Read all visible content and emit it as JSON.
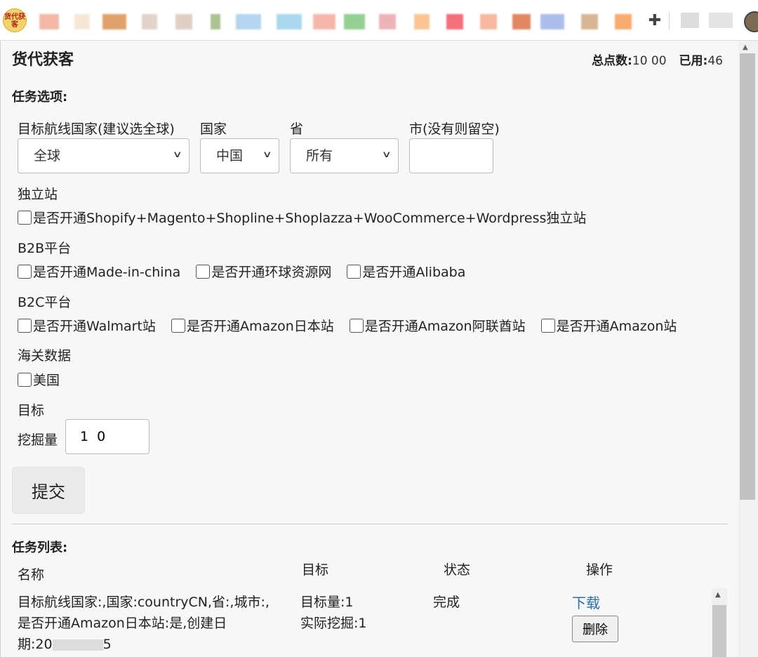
{
  "toolbar": {
    "ext_icon_text": "货代获客",
    "puzzle_icon": "puzzle-icon"
  },
  "header": {
    "title": "货代获客",
    "total_label": "总点数:",
    "total_value": "10  00",
    "used_label": "已用:",
    "used_value": "46"
  },
  "options": {
    "section_title": "任务选项:",
    "route_label": "目标航线国家(建议选全球)",
    "route_value": "全球",
    "country_label": "国家",
    "country_value": "中国",
    "province_label": "省",
    "province_value": "所有",
    "city_label": "市(没有则留空)",
    "city_value": "",
    "independent_label": "独立站",
    "independent_cb": "是否开通Shopify+Magento+Shopline+Shoplazza+WooCommerce+Wordpress独立站",
    "b2b_label": "B2B平台",
    "b2b_cb1": "是否开通Made-in-china",
    "b2b_cb2": "是否开通环球资源网",
    "b2b_cb3": "是否开通Alibaba",
    "b2c_label": "B2C平台",
    "b2c_cb1": "是否开通Walmart站",
    "b2c_cb2": "是否开通Amazon日本站",
    "b2c_cb3": "是否开通Amazon阿联酋站",
    "b2c_cb4": "是否开通Amazon站",
    "customs_label": "海关数据",
    "customs_cb1": "美国",
    "target_label": "目标",
    "amount_label": "挖掘量",
    "amount_value": "1  0",
    "submit_label": "提交"
  },
  "tasks": {
    "section_title": "任务列表:",
    "col_name": "名称",
    "col_target": "目标",
    "col_status": "状态",
    "col_action": "操作",
    "rows": [
      {
        "name_line1": "目标航线国家:,国家:countryCN,省:,城市:,",
        "name_line2": "是否开通Amazon日本站:是,创建日",
        "name_line3_prefix": "期:20",
        "name_line3_suffix": "5",
        "target_line1": "目标量:1",
        "target_line2": "实际挖掘:1",
        "status": "完成",
        "download_label": "下载",
        "delete_label": "删除"
      }
    ]
  },
  "colors": {
    "link": "#2a6fb0",
    "background": "#f7f7f7"
  }
}
